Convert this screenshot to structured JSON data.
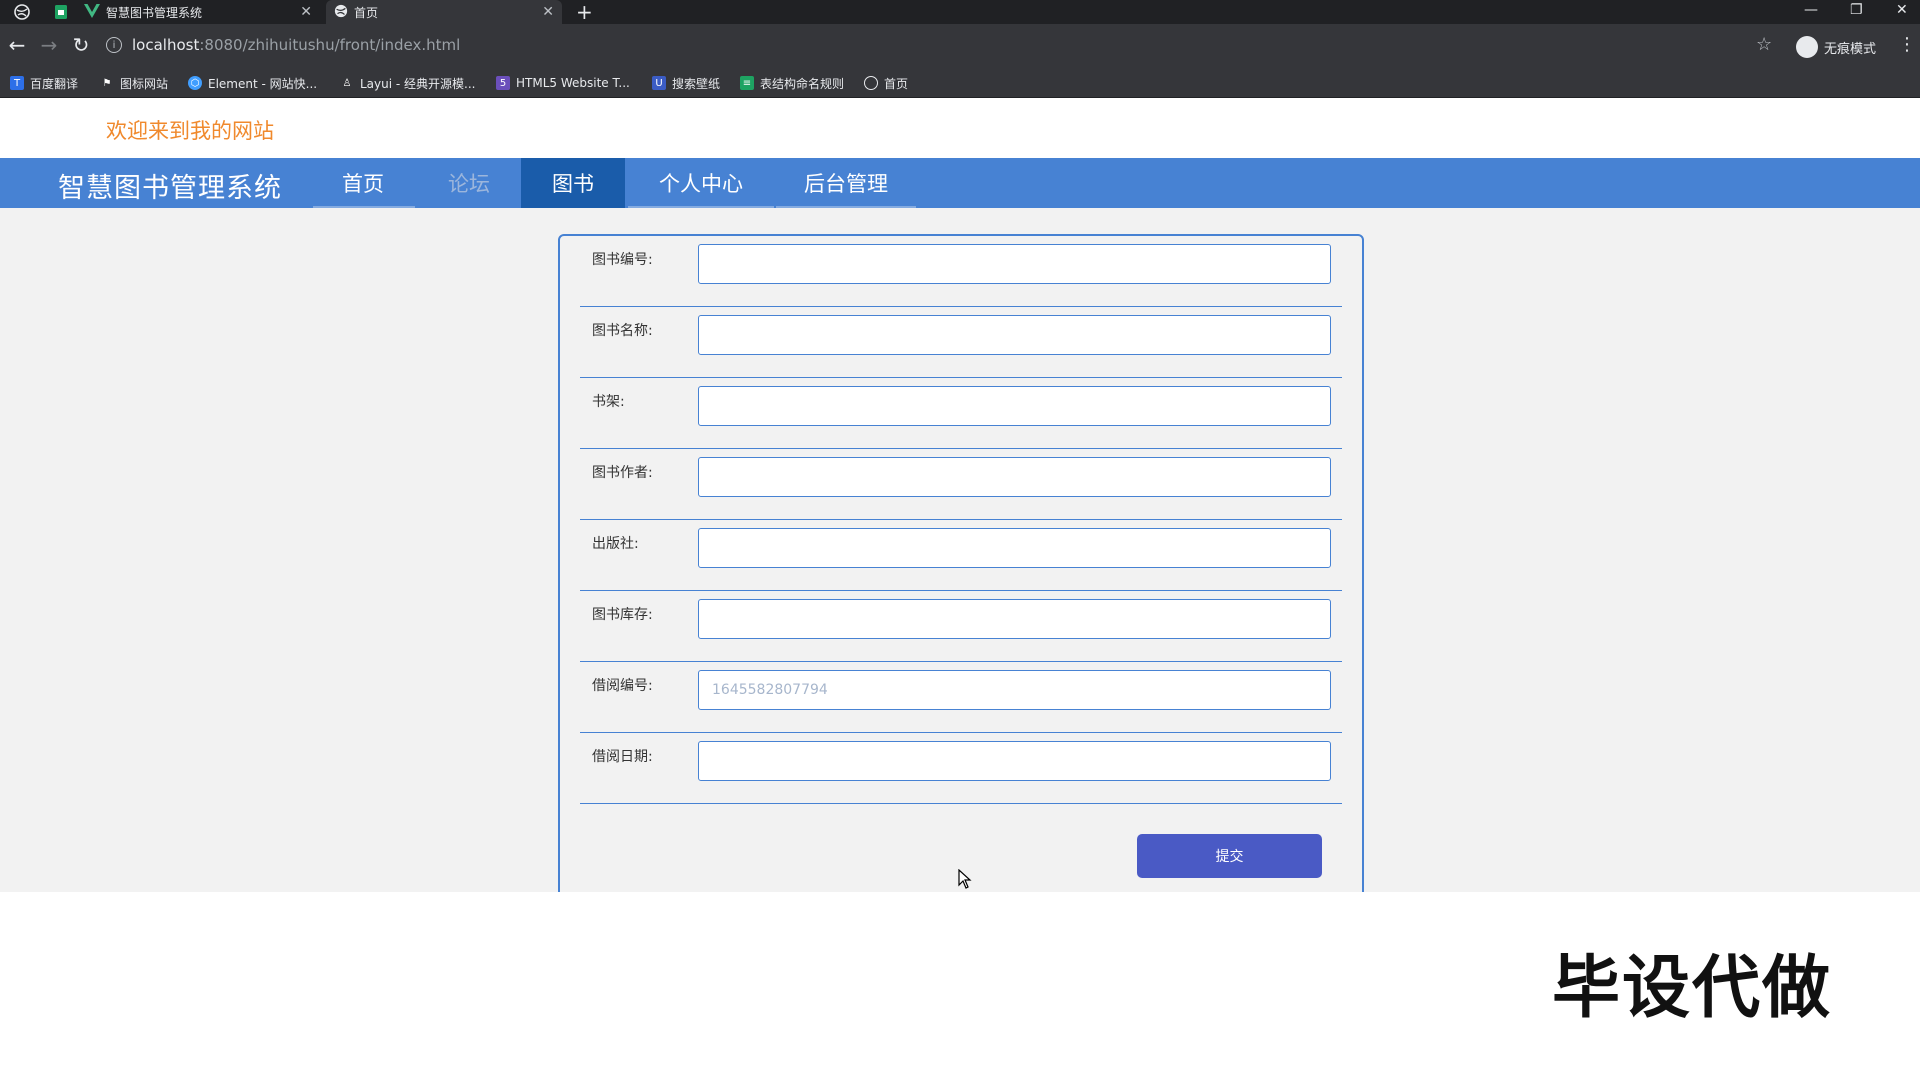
{
  "browser": {
    "tabs": [
      {
        "title": "智慧图书管理系统",
        "active": false
      },
      {
        "title": "首页",
        "active": true
      }
    ],
    "new_tab": "+",
    "address": {
      "host": "localhost",
      "path": ":8080/zhihuitushu/front/index.html"
    },
    "profile_label": "无痕模式",
    "bookmarks": [
      {
        "label": "百度翻译",
        "icon": "baidu-translate-icon",
        "color": "#2d6fe8"
      },
      {
        "label": "图标网站",
        "icon": "flag-icon",
        "color": "#35363a"
      },
      {
        "label": "Element - 网站快...",
        "icon": "element-icon",
        "color": "#409eff"
      },
      {
        "label": "Layui - 经典开源模...",
        "icon": "layui-icon",
        "color": "#35363a"
      },
      {
        "label": "HTML5 Website T...",
        "icon": "html5-icon",
        "color": "#6b4fbb"
      },
      {
        "label": "搜索壁纸",
        "icon": "wallpaper-icon",
        "color": "#3b5cc4"
      },
      {
        "label": "表结构命名规则",
        "icon": "sheet-icon",
        "color": "#1ea362"
      },
      {
        "label": "首页",
        "icon": "globe-icon",
        "color": "#35363a"
      }
    ]
  },
  "site": {
    "welcome": "欢迎来到我的网站",
    "brand": "智慧图书管理系统",
    "nav": [
      {
        "label": "首页",
        "state": "normal"
      },
      {
        "label": "论坛",
        "state": "dim"
      },
      {
        "label": "图书",
        "state": "active"
      },
      {
        "label": "个人中心",
        "state": "normal"
      },
      {
        "label": "后台管理",
        "state": "normal"
      }
    ],
    "colors": {
      "navbar": "#4782d3",
      "active_nav": "#1a5caa",
      "welcome": "#f0892c",
      "submit": "#4a5ac5"
    }
  },
  "form": {
    "fields": [
      {
        "label": "图书编号:",
        "value": ""
      },
      {
        "label": "图书名称:",
        "value": ""
      },
      {
        "label": "书架:",
        "value": ""
      },
      {
        "label": "图书作者:",
        "value": ""
      },
      {
        "label": "出版社:",
        "value": ""
      },
      {
        "label": "图书库存:",
        "value": ""
      },
      {
        "label": "借阅编号:",
        "value": "1645582807794"
      },
      {
        "label": "借阅日期:",
        "value": ""
      }
    ],
    "submit_label": "提交"
  },
  "watermark": "毕设代做"
}
